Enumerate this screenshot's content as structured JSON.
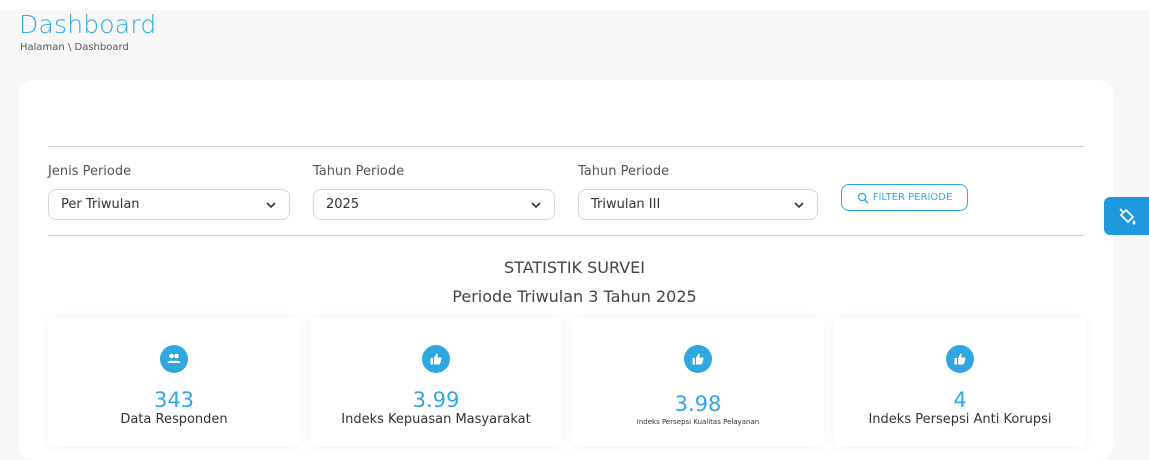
{
  "header": {
    "title": "Dashboard",
    "breadcrumb": "Halaman \\ Dashboard"
  },
  "filters": [
    {
      "label": "Jenis Periode",
      "value": "Per Triwulan"
    },
    {
      "label": "Tahun Periode",
      "value": "2025"
    },
    {
      "label": "Tahun Periode",
      "value": "Triwulan III"
    }
  ],
  "filter_button": {
    "label": "FILTER PERIODE",
    "icon": "search-icon"
  },
  "side_button": {
    "icon": "paint-bucket-icon"
  },
  "statistics": {
    "title": "STATISTIK SURVEI",
    "period": "Periode Triwulan 3 Tahun 2025",
    "cards": [
      {
        "icon": "users-icon",
        "value": "343",
        "label": "Data Responden"
      },
      {
        "icon": "thumbs-up-icon",
        "value": "3.99",
        "label": "Indeks Kepuasan Masyarakat"
      },
      {
        "icon": "thumbs-up-icon",
        "value": "3.98",
        "label": "Indeks Persepsi Kualitas Pelayanan"
      },
      {
        "icon": "thumbs-up-icon",
        "value": "4",
        "label": "Indeks Persepsi Anti Korupsi"
      }
    ]
  },
  "colors": {
    "accent": "#2fa8e0",
    "side_button": "#1e98dc"
  }
}
